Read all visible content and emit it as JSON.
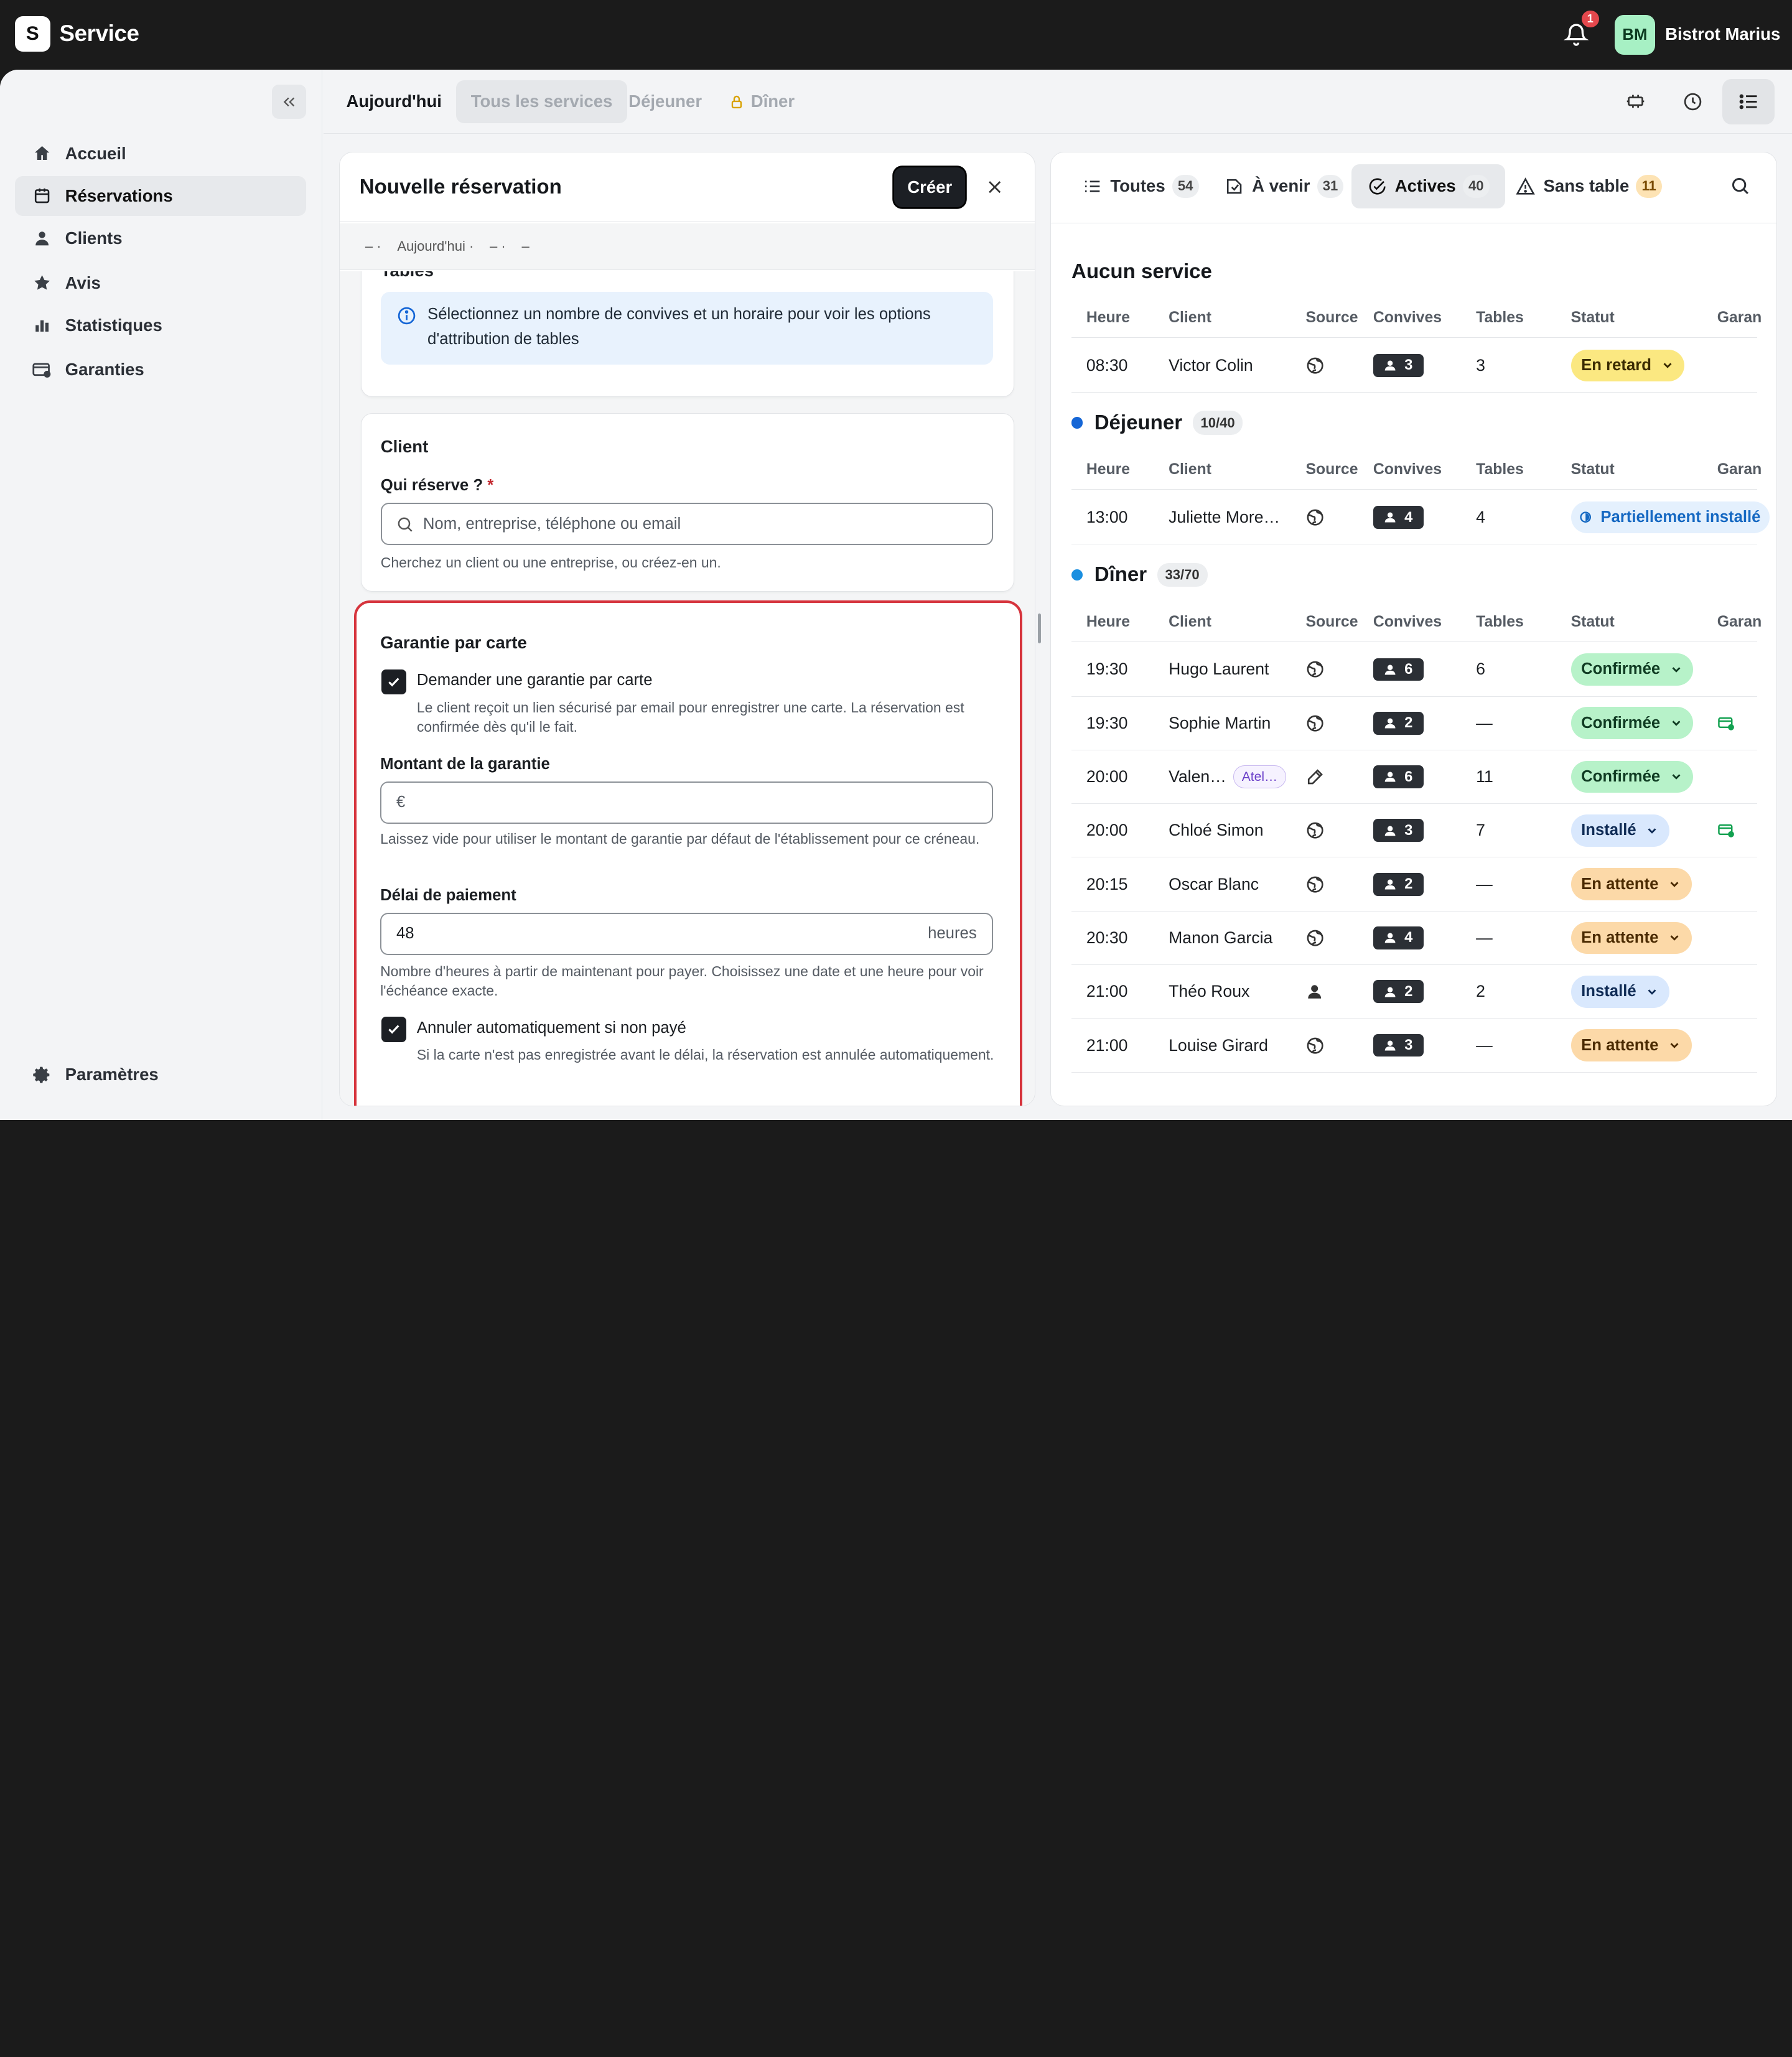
{
  "app": {
    "logo_letter": "S",
    "title": "Service",
    "notifications": "1",
    "avatar_initials": "BM",
    "restaurant": "Bistrot Marius"
  },
  "sidebar": {
    "items": [
      {
        "label": "Accueil",
        "icon": "home-icon"
      },
      {
        "label": "Réservations",
        "icon": "calendar-icon"
      },
      {
        "label": "Clients",
        "icon": "person-icon"
      },
      {
        "label": "Avis",
        "icon": "star-icon"
      },
      {
        "label": "Statistiques",
        "icon": "bar-chart-icon"
      },
      {
        "label": "Garanties",
        "icon": "card-icon"
      }
    ],
    "settings": "Paramètres"
  },
  "services": {
    "today": "Aujourd'hui",
    "all": "Tous les services",
    "lunch": "Déjeuner",
    "dinner": "Dîner"
  },
  "new_reservation": {
    "title": "Nouvelle réservation",
    "create": "Créer",
    "summary": [
      "– ·",
      "Aujourd'hui ·",
      "– ·",
      "–"
    ],
    "tables": {
      "title": "Tables",
      "info": "Sélectionnez un nombre de convives et un horaire pour voir les options d'attribution de tables"
    },
    "client": {
      "title": "Client",
      "label": "Qui réserve ?",
      "required": "*",
      "placeholder": "Nom, entreprise, téléphone ou email",
      "hint": "Cherchez un client ou une entreprise, ou créez-en un."
    },
    "guarantee": {
      "title": "Garantie par carte",
      "request_label": "Demander une garantie par carte",
      "request_desc": "Le client reçoit un lien sécurisé par email pour enregistrer une carte. La réservation est confirmée dès qu'il le fait.",
      "amount_label": "Montant de la garantie",
      "amount_prefix": "€",
      "amount_hint": "Laissez vide pour utiliser le montant de garantie par défaut de l'établissement pour ce créneau.",
      "delay_label": "Délai de paiement",
      "delay_value": "48",
      "delay_unit": "heures",
      "delay_hint": "Nombre d'heures à partir de maintenant pour payer. Choisissez une date et une heure pour voir l'échéance exacte.",
      "cancel_label": "Annuler automatiquement si non payé",
      "cancel_desc": "Si la carte n'est pas enregistrée avant le délai, la réservation est annulée automatiquement."
    }
  },
  "list": {
    "tabs": [
      {
        "label": "Toutes",
        "count": "54"
      },
      {
        "label": "À venir",
        "count": "31"
      },
      {
        "label": "Actives",
        "count": "40"
      },
      {
        "label": "Sans table",
        "count": "11"
      }
    ],
    "columns": {
      "time": "Heure",
      "client": "Client",
      "source": "Source",
      "guests": "Convives",
      "tables": "Tables",
      "status": "Statut",
      "garan": "Garan"
    },
    "sections": [
      {
        "title": "Aucun service",
        "occupancy": ""
      },
      {
        "title": "Déjeuner",
        "occupancy": "10/40",
        "color": "#1566d6"
      },
      {
        "title": "Dîner",
        "occupancy": "33/70",
        "color": "#1a8fe0"
      }
    ],
    "rows_none": [
      {
        "time": "08:30",
        "client": "Victor Colin",
        "guests": "3",
        "tables": "3",
        "status": "En retard"
      }
    ],
    "rows_lunch": [
      {
        "time": "13:00",
        "client": "Juliette More…",
        "guests": "4",
        "tables": "4",
        "status": "Partiellement installé"
      }
    ],
    "rows_dinner": [
      {
        "time": "19:30",
        "client": "Hugo Laurent",
        "guests": "6",
        "tables": "6",
        "status": "Confirmée"
      },
      {
        "time": "19:30",
        "client": "Sophie Martin",
        "guests": "2",
        "tables": "—",
        "status": "Confirmée"
      },
      {
        "time": "20:00",
        "client": "Valen…",
        "tag": "Atel…",
        "guests": "6",
        "tables": "11",
        "status": "Confirmée"
      },
      {
        "time": "20:00",
        "client": "Chloé Simon",
        "guests": "3",
        "tables": "7",
        "status": "Installé"
      },
      {
        "time": "20:15",
        "client": "Oscar Blanc",
        "guests": "2",
        "tables": "—",
        "status": "En attente"
      },
      {
        "time": "20:30",
        "client": "Manon Garcia",
        "guests": "4",
        "tables": "—",
        "status": "En attente"
      },
      {
        "time": "21:00",
        "client": "Théo Roux",
        "guests": "2",
        "tables": "2",
        "status": "Installé"
      },
      {
        "time": "21:00",
        "client": "Louise Girard",
        "guests": "3",
        "tables": "—",
        "status": "En attente"
      }
    ]
  }
}
